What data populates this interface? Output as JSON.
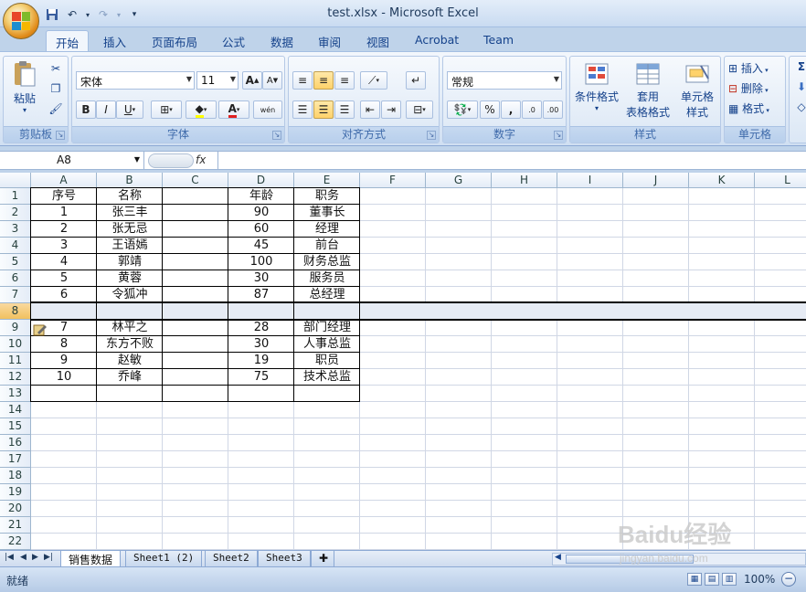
{
  "window": {
    "title": "test.xlsx - Microsoft Excel"
  },
  "qat": {
    "save_icon": "save-icon",
    "undo_icon": "undo-icon",
    "redo_icon": "redo-icon"
  },
  "tabs": [
    "开始",
    "插入",
    "页面布局",
    "公式",
    "数据",
    "审阅",
    "视图",
    "Acrobat",
    "Team"
  ],
  "ribbon": {
    "clipboard": {
      "label": "剪贴板",
      "paste": "粘贴"
    },
    "font": {
      "label": "字体",
      "name": "宋体",
      "size": "11",
      "bold": "B",
      "italic": "I",
      "underline": "U",
      "font_color": "A",
      "grow": "A",
      "shrink": "A",
      "wen": "wén"
    },
    "alignment": {
      "label": "对齐方式"
    },
    "number": {
      "label": "数字",
      "format": "常规",
      "percent": "%",
      "comma": ",",
      "inc_dec": ".0",
      "dec_dec": ".00"
    },
    "styles": {
      "label": "样式",
      "cond_format": "条件格式",
      "table_format_1": "套用",
      "table_format_2": "表格格式",
      "cell_style_1": "单元格",
      "cell_style_2": "样式"
    },
    "cells": {
      "label": "单元格",
      "insert": "插入",
      "delete": "删除",
      "format": "格式"
    },
    "editing": {
      "sigma": "Σ"
    }
  },
  "formula_bar": {
    "name_box": "A8",
    "fx": "fx",
    "formula": ""
  },
  "columns": [
    "A",
    "B",
    "C",
    "D",
    "E",
    "F",
    "G",
    "H",
    "I",
    "J",
    "K",
    "L"
  ],
  "rows": [
    "1",
    "2",
    "3",
    "4",
    "5",
    "6",
    "7",
    "8",
    "9",
    "10",
    "11",
    "12",
    "13",
    "14",
    "15",
    "16",
    "17",
    "18",
    "19",
    "20",
    "21",
    "22"
  ],
  "table": [
    [
      "序号",
      "名称",
      "",
      "年龄",
      "职务"
    ],
    [
      "1",
      "张三丰",
      "",
      "90",
      "董事长"
    ],
    [
      "2",
      "张无忌",
      "",
      "60",
      "经理"
    ],
    [
      "3",
      "王语嫣",
      "",
      "45",
      "前台"
    ],
    [
      "4",
      "郭靖",
      "",
      "100",
      "财务总监"
    ],
    [
      "5",
      "黄蓉",
      "",
      "30",
      "服务员"
    ],
    [
      "6",
      "令狐冲",
      "",
      "87",
      "总经理"
    ],
    [
      "",
      "",
      "",
      "",
      ""
    ],
    [
      "7",
      "林平之",
      "",
      "28",
      "部门经理"
    ],
    [
      "8",
      "东方不败",
      "",
      "30",
      "人事总监"
    ],
    [
      "9",
      "赵敏",
      "",
      "19",
      "职员"
    ],
    [
      "10",
      "乔峰",
      "",
      "75",
      "技术总监"
    ],
    [
      "",
      "",
      "",
      "",
      ""
    ]
  ],
  "sheets": [
    "销售数据",
    "Sheet1 (2)",
    "Sheet2",
    "Sheet3"
  ],
  "status": {
    "ready": "就绪",
    "zoom": "100%"
  },
  "watermark": {
    "brand": "Baidu经验",
    "url": "jingyan.baidu.com"
  }
}
